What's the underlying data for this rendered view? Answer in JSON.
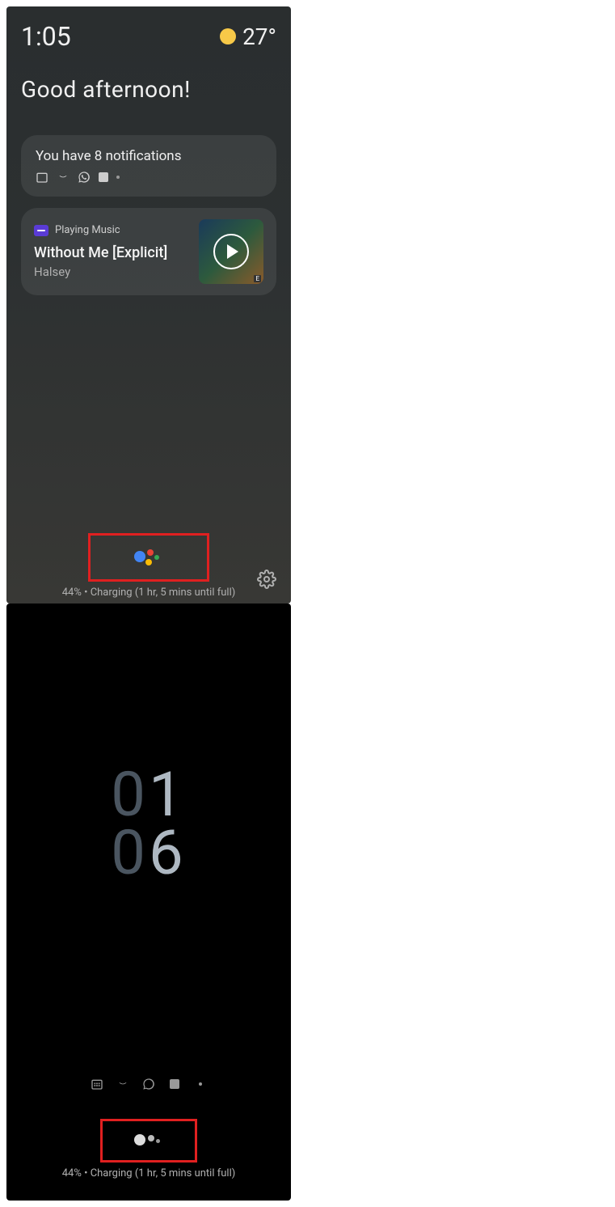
{
  "left": {
    "status": {
      "time": "1:05",
      "temp": "27°"
    },
    "greeting": "Good afternoon!",
    "notifications": {
      "title": "You have 8 notifications"
    },
    "music": {
      "label": "Playing Music",
      "title": "Without Me [Explicit]",
      "artist": "Halsey"
    },
    "charging": "44% • Charging (1 hr, 5 mins until full)"
  },
  "right": {
    "clock": {
      "h1": "0",
      "h2": "1",
      "m1": "0",
      "m2": "6"
    },
    "charging": "44% • Charging (1 hr, 5 mins until full)"
  }
}
